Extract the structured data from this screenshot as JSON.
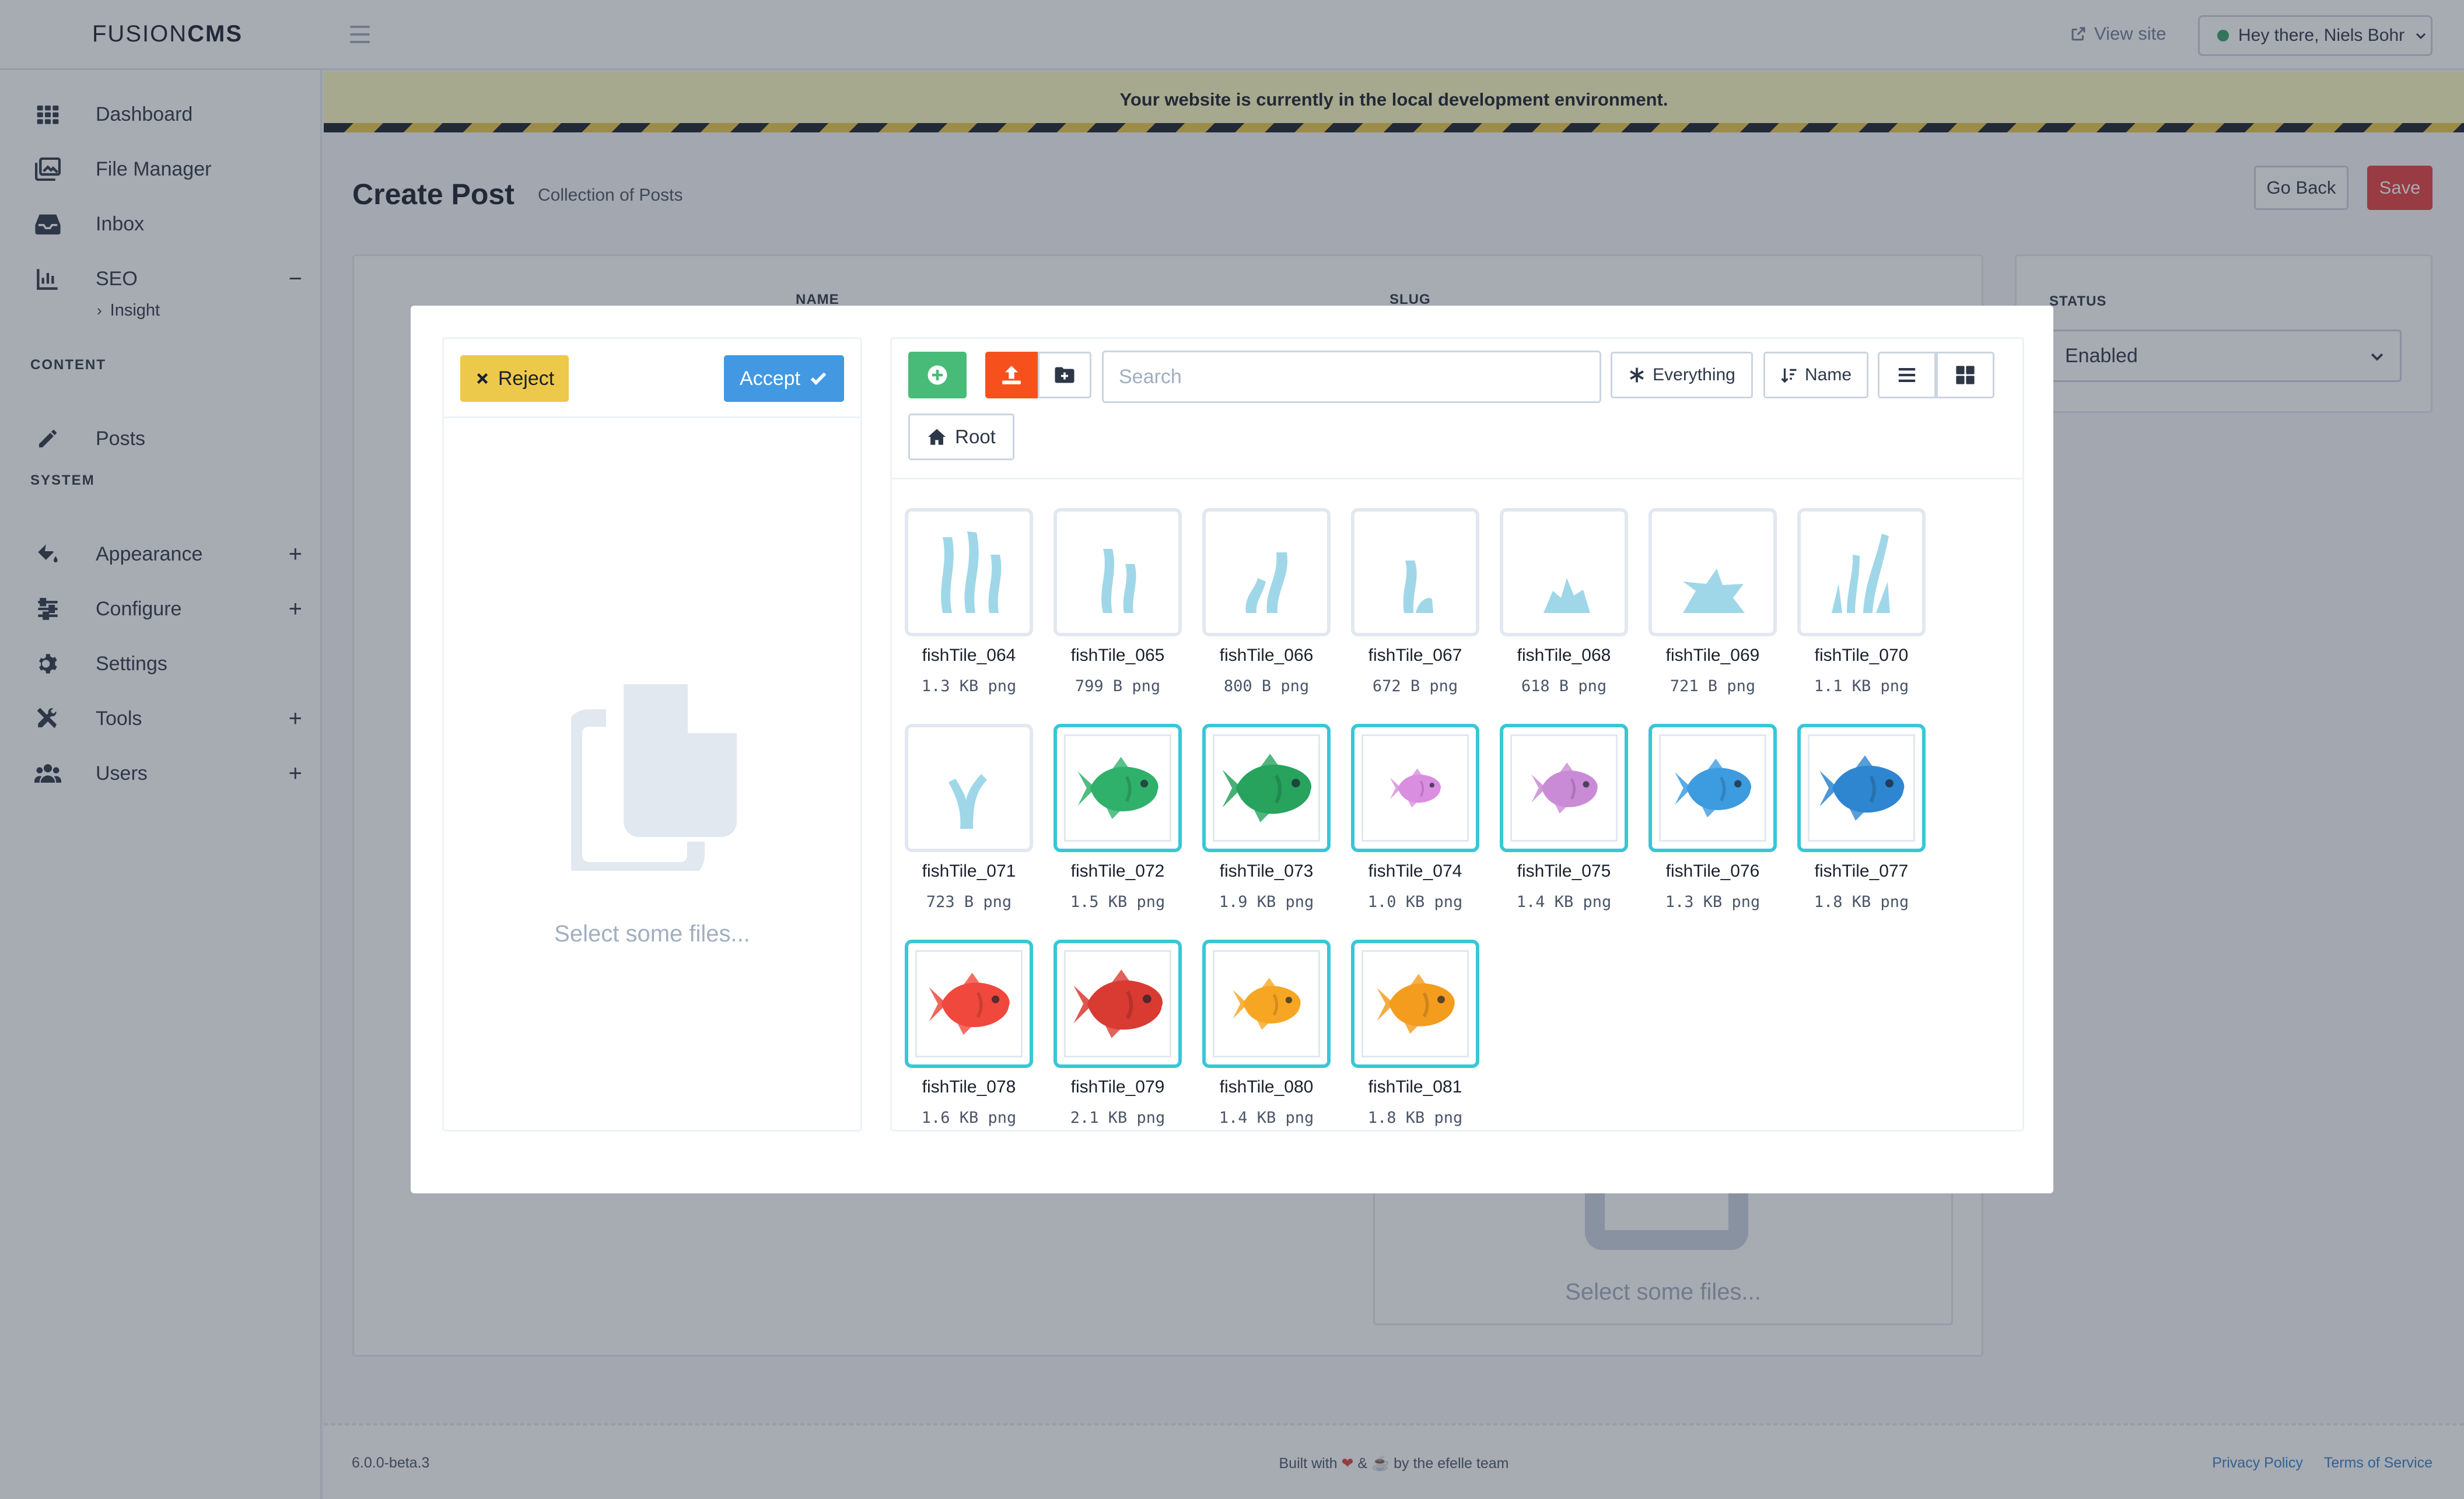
{
  "app": {
    "logo_light": "FUSION",
    "logo_bold": "CMS"
  },
  "header": {
    "view_site": "View site",
    "user_greeting": "Hey there, Niels Bohr"
  },
  "sidebar": {
    "items": [
      {
        "label": "Dashboard",
        "icon": "grid-icon"
      },
      {
        "label": "File Manager",
        "icon": "images-icon"
      },
      {
        "label": "Inbox",
        "icon": "inbox-icon"
      },
      {
        "label": "SEO",
        "icon": "chart-icon",
        "toggle": "−"
      },
      {
        "label": "Posts",
        "icon": "pencil-icon"
      },
      {
        "label": "Appearance",
        "icon": "paint-bucket-icon",
        "toggle": "+"
      },
      {
        "label": "Configure",
        "icon": "sliders-icon",
        "toggle": "+"
      },
      {
        "label": "Settings",
        "icon": "gear-icon"
      },
      {
        "label": "Tools",
        "icon": "tools-icon",
        "toggle": "+"
      },
      {
        "label": "Users",
        "icon": "users-icon",
        "toggle": "+"
      }
    ],
    "seo_sub": "Insight",
    "heading_content": "CONTENT",
    "heading_system": "SYSTEM"
  },
  "banner": {
    "text": "Your website is currently in the local development environment."
  },
  "page": {
    "title": "Create Post",
    "subtitle": "Collection of Posts",
    "go_back": "Go Back",
    "save": "Save",
    "field_name": "NAME",
    "field_slug": "SLUG",
    "status_label": "STATUS",
    "status_value": "Enabled",
    "bg_empty": "Select some files..."
  },
  "footer": {
    "version": "6.0.0-beta.3",
    "built_prefix": "Built with",
    "built_amp": "&",
    "built_suffix": "by the efelle team",
    "privacy": "Privacy Policy",
    "terms": "Terms of Service"
  },
  "modal": {
    "reject": "Reject",
    "accept": "Accept",
    "empty_text": "Select some files...",
    "search_placeholder": "Search",
    "filter": "Everything",
    "sort": "Name",
    "root": "Root",
    "files": [
      {
        "name": "fishTile_064",
        "meta": "1.3 KB png",
        "kind": "seaweed",
        "selected": false,
        "color": "#9fd7e8"
      },
      {
        "name": "fishTile_065",
        "meta": "799 B png",
        "kind": "seaweed",
        "selected": false,
        "color": "#9fd7e8"
      },
      {
        "name": "fishTile_066",
        "meta": "800 B png",
        "kind": "seaweed",
        "selected": false,
        "color": "#9fd7e8"
      },
      {
        "name": "fishTile_067",
        "meta": "672 B png",
        "kind": "seaweed",
        "selected": false,
        "color": "#9fd7e8"
      },
      {
        "name": "fishTile_068",
        "meta": "618 B png",
        "kind": "seaweed",
        "selected": false,
        "color": "#9fd7e8"
      },
      {
        "name": "fishTile_069",
        "meta": "721 B png",
        "kind": "seaweed",
        "selected": false,
        "color": "#9fd7e8"
      },
      {
        "name": "fishTile_070",
        "meta": "1.1 KB png",
        "kind": "seaweed",
        "selected": false,
        "color": "#9fd7e8"
      },
      {
        "name": "fishTile_071",
        "meta": "723 B png",
        "kind": "seaweed",
        "selected": false,
        "color": "#9fd7e8"
      },
      {
        "name": "fishTile_072",
        "meta": "1.5 KB png",
        "kind": "fish",
        "selected": true,
        "color": "#2fb16b"
      },
      {
        "name": "fishTile_073",
        "meta": "1.9 KB png",
        "kind": "fish",
        "selected": true,
        "color": "#27a35d"
      },
      {
        "name": "fishTile_074",
        "meta": "1.0 KB png",
        "kind": "fish",
        "selected": true,
        "color": "#d98ee0"
      },
      {
        "name": "fishTile_075",
        "meta": "1.4 KB png",
        "kind": "fish",
        "selected": true,
        "color": "#c98bd6"
      },
      {
        "name": "fishTile_076",
        "meta": "1.3 KB png",
        "kind": "fish",
        "selected": true,
        "color": "#3d9be0"
      },
      {
        "name": "fishTile_077",
        "meta": "1.8 KB png",
        "kind": "fish",
        "selected": true,
        "color": "#2d86cf"
      },
      {
        "name": "fishTile_078",
        "meta": "1.6 KB png",
        "kind": "fish",
        "selected": true,
        "color": "#f0483c"
      },
      {
        "name": "fishTile_079",
        "meta": "2.1 KB png",
        "kind": "fish",
        "selected": true,
        "color": "#d93a32"
      },
      {
        "name": "fishTile_080",
        "meta": "1.4 KB png",
        "kind": "fish",
        "selected": true,
        "color": "#f6a623"
      },
      {
        "name": "fishTile_081",
        "meta": "1.8 KB png",
        "kind": "fish",
        "selected": true,
        "color": "#f39c1e"
      }
    ]
  }
}
